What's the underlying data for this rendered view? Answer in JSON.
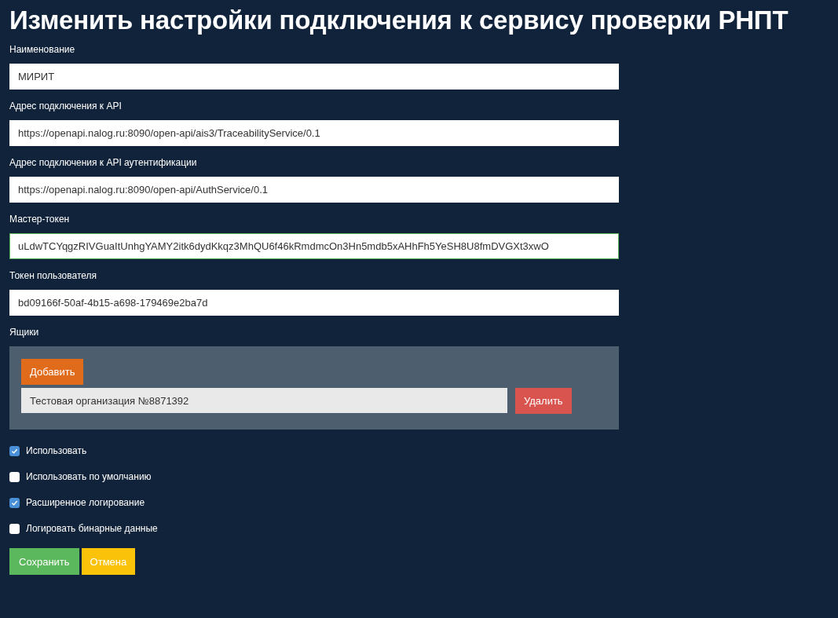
{
  "title": "Изменить настройки подключения к сервису проверки РНПТ",
  "fields": [
    {
      "label": "Наименование",
      "value": "МИРИТ",
      "focused": false
    },
    {
      "label": "Адрес подключения к API",
      "value": "https://openapi.nalog.ru:8090/open-api/ais3/TraceabilityService/0.1",
      "focused": false
    },
    {
      "label": "Адрес подключения к API аутентификации",
      "value": "https://openapi.nalog.ru:8090/open-api/AuthService/0.1",
      "focused": false
    },
    {
      "label": "Мастер-токен",
      "value": "uLdwTCYqgzRIVGuaItUnhgYAMY2itk6dydKkqz3MhQU6f46kRmdmcOn3Hn5mdb5xAHhFh5YeSH8U8fmDVGXt3xwO",
      "focused": true
    },
    {
      "label": "Токен пользователя",
      "value": "bd09166f-50af-4b15-a698-179469e2ba7d",
      "focused": false
    }
  ],
  "boxes": {
    "label": "Ящики",
    "add_button": "Добавить",
    "items": [
      {
        "value": "Тестовая организация №8871392",
        "delete_button": "Удалить"
      }
    ]
  },
  "checkboxes": [
    {
      "label": "Использовать",
      "checked": true
    },
    {
      "label": "Использовать по умолчанию",
      "checked": false
    },
    {
      "label": "Расширенное логирование",
      "checked": true
    },
    {
      "label": "Логировать бинарные данные",
      "checked": false
    }
  ],
  "buttons": [
    {
      "label": "Сохранить",
      "kind": "save"
    },
    {
      "label": "Отмена",
      "kind": "cancel"
    }
  ]
}
